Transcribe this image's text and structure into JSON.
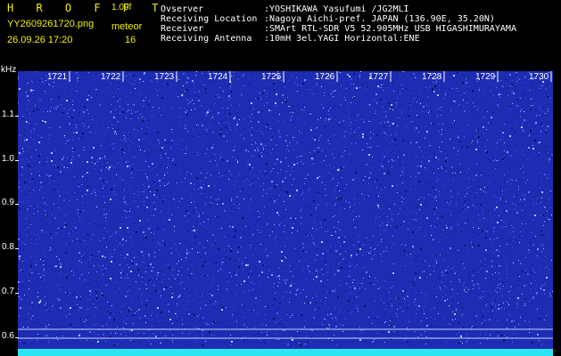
{
  "header": {
    "title": "H R O F F T",
    "version": "1.00f",
    "filename": "YY2609261720.png",
    "mode": "meteor",
    "datetime": "26.09.26 17:20",
    "count": "16"
  },
  "info": [
    {
      "label": "Ovserver",
      "value": ":YOSHIKAWA Yasufumi /JG2MLI"
    },
    {
      "label": "Receiving Location",
      "value": ":Nagoya Aichi-pref. JAPAN (136.90E, 35.20N)"
    },
    {
      "label": "Receiver",
      "value": ":SMArt RTL-SDR V5 52.905MHz USB HIGASHIMURAYAMA"
    },
    {
      "label": "Receiving Antenna",
      "value": ":10mH 3el.YAGI Horizontal:ENE"
    }
  ],
  "axis": {
    "y_unit": "kHz",
    "y_ticks": [
      "1.1",
      "1.0",
      "0.9",
      "0.8",
      "0.7",
      "0.6"
    ],
    "x_ticks": [
      "1721",
      "1722",
      "1723",
      "1724",
      "1725",
      "1726",
      "1727",
      "1728",
      "1729",
      "1730"
    ]
  },
  "colors": {
    "background": "#000000",
    "header_text": "#f4f000",
    "info_text": "#ffffff",
    "waterfall_base": "#1d2cb2",
    "bottom_band": "#2ae6f2"
  }
}
